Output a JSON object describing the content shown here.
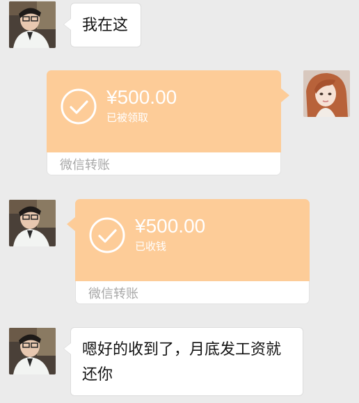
{
  "chat": {
    "msg1": {
      "text": "我在这"
    },
    "transfer1": {
      "amount": "¥500.00",
      "status": "已被领取",
      "label": "微信转账"
    },
    "transfer2": {
      "amount": "¥500.00",
      "status": "已收钱",
      "label": "微信转账"
    },
    "msg4": {
      "line1": "嗯好的收到了，月底发工资就",
      "line2": "还你"
    }
  },
  "colors": {
    "background": "#ebebeb",
    "transfer_orange": "#fdcc98",
    "bubble_white": "#ffffff",
    "label_gray": "#a8a8a8"
  },
  "icons": {
    "check": "check-circle-icon",
    "avatar_male": "avatar",
    "avatar_female": "avatar"
  }
}
